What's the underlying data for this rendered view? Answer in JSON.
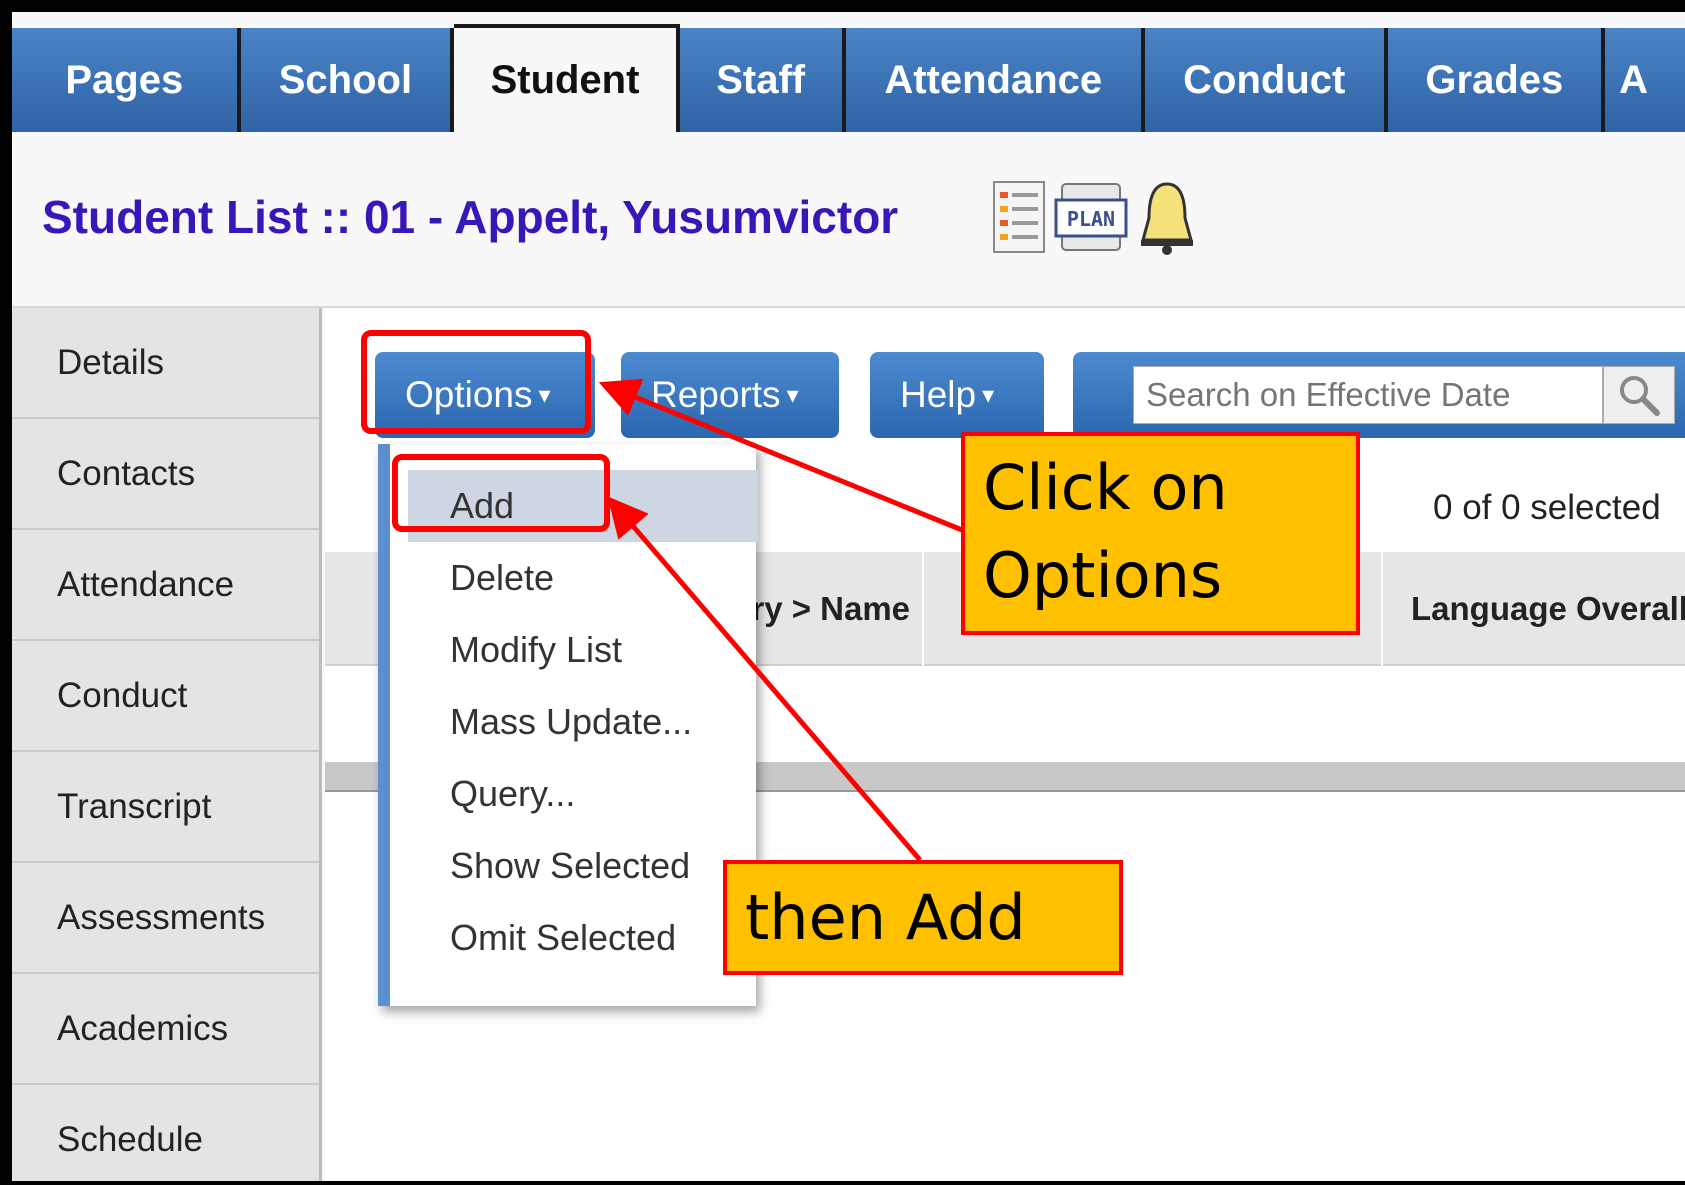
{
  "tabs": [
    "Pages",
    "School",
    "Student",
    "Staff",
    "Attendance",
    "Conduct",
    "Grades",
    "A"
  ],
  "active_tab": "Student",
  "page_title": "Student List :: 01 - Appelt, Yusumvictor",
  "title_icons": [
    "list-icon",
    "plan-icon",
    "bell-icon"
  ],
  "plan_icon_text": "PLAN",
  "sidebar": {
    "items": [
      "Details",
      "Contacts",
      "Attendance",
      "Conduct",
      "Transcript",
      "Assessments",
      "Academics",
      "Schedule"
    ]
  },
  "toolbar": {
    "options_label": "Options",
    "reports_label": "Reports",
    "help_label": "Help",
    "caret": "▾"
  },
  "search": {
    "placeholder": "Search on Effective Date"
  },
  "selected_count": "0 of 0 selected",
  "grid": {
    "columns": [
      "ary > Name",
      "Language Overall"
    ]
  },
  "options_menu": {
    "items": [
      "Add",
      "Delete",
      "Modify List",
      "Mass Update...",
      "Query...",
      "Show Selected",
      "Omit Selected"
    ],
    "highlighted": "Add"
  },
  "annotations": {
    "callout_1": [
      "Click on",
      "Options"
    ],
    "callout_2": "then Add",
    "accent_color": "#ff0000",
    "callout_fill": "#ffc000"
  }
}
